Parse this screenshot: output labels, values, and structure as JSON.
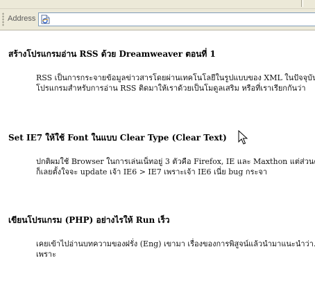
{
  "addressbar": {
    "label": "Address",
    "url": ""
  },
  "posts": [
    {
      "title": "สร้างโปรแกรมอ่าน RSS ด้วย Dreamweaver ตอนที่ 1",
      "excerpt_lines": [
        "RSS เป็นการกระจายข้อมูลข่าวสารโดยผ่านเทคโนโลยีในรูปแบบของ XML ในปัจจุบันเรา",
        "โปรแกรมสำหรับการอ่าน RSS ติดมาให้เราด้วยเป็นโมดูลเสริม หรือที่เราเรียกกันว่า"
      ]
    },
    {
      "title": "Set IE7 ให้ใช้ Font ในแบบ Clear Type (Clear Text)",
      "excerpt_lines": [
        "ปกติผมใช้ Browser ในการเล่นเน็ทอยู่ 3 ตัวคือ Firefox, IE และ Maxthon แต่ส่วนตัวจะ",
        "ก็เลยตั้งใจจะ update เจ้า IE6 > IE7 เพราะเจ้า IE6 เนี่ย bug กระจา"
      ]
    },
    {
      "title": "เขียนโปรแกรม (PHP) อย่างไรให้ Run เร็ว",
      "excerpt_lines": [
        "เคยเข้าไปอ่านบทความของฝรั่ง (Eng) เขามา เรื่องของการพิสูจน์แล้วนำมาแนะนำว่า... เรา",
        "เพราะ"
      ]
    }
  ]
}
